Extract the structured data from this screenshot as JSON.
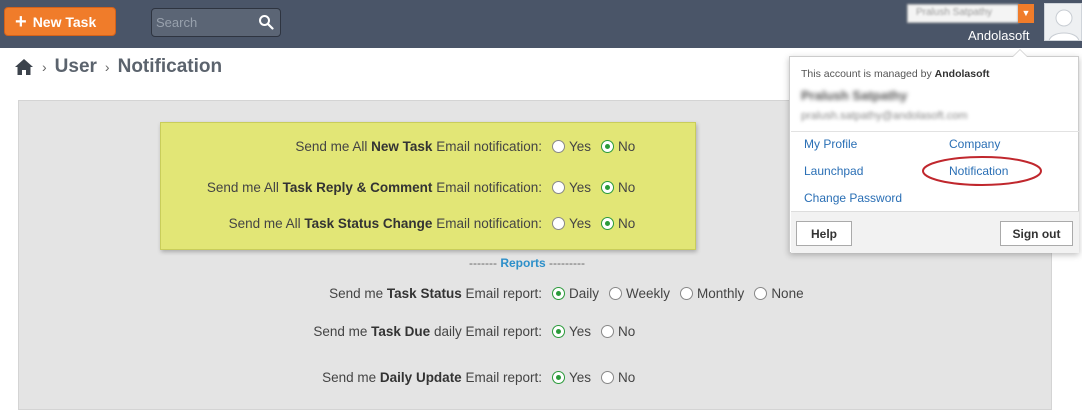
{
  "header": {
    "new_task_label": "New Task",
    "search_placeholder": "Search",
    "user_select_value": "Pralush Satpathy",
    "company": "Andolasoft"
  },
  "breadcrumb": {
    "items": [
      "User",
      "Notification"
    ]
  },
  "email_notifications": [
    {
      "prefix": "Send me All",
      "bold": "New Task",
      "suffix": "Email notification:",
      "options": [
        "Yes",
        "No"
      ],
      "selected": "No"
    },
    {
      "prefix": "Send me All",
      "bold": "Task Reply & Comment",
      "suffix": "Email notification:",
      "options": [
        "Yes",
        "No"
      ],
      "selected": "No"
    },
    {
      "prefix": "Send me All",
      "bold": "Task Status Change",
      "suffix": "Email notification:",
      "options": [
        "Yes",
        "No"
      ],
      "selected": "No"
    }
  ],
  "reports": {
    "divider_left": "-------",
    "title": "Reports",
    "divider_right": "---------",
    "rows": [
      {
        "prefix": "Send me",
        "bold": "Task Status",
        "suffix": "Email report:",
        "options": [
          "Daily",
          "Weekly",
          "Monthly",
          "None"
        ],
        "selected": "Daily"
      },
      {
        "prefix": "Send me",
        "bold": "Task Due",
        "suffix": "daily Email report:",
        "options": [
          "Yes",
          "No"
        ],
        "selected": "Yes"
      },
      {
        "prefix": "Send me",
        "bold": "Daily Update",
        "suffix": "Email report:",
        "options": [
          "Yes",
          "No"
        ],
        "selected": "Yes"
      }
    ]
  },
  "dropdown": {
    "managed_prefix": "This account is managed by",
    "managed_org": "Andolasoft",
    "account_name": "Pralush Satpathy",
    "account_email": "pralush.satpathy@andolasoft.com",
    "links": [
      "My Profile",
      "Company",
      "Launchpad",
      "Notification",
      "Change Password"
    ],
    "help_label": "Help",
    "signout_label": "Sign out"
  },
  "colors": {
    "topbar": "#4a5568",
    "accent_orange": "#f07c2a",
    "yellow_highlight": "#e2e676",
    "link_blue": "#2a6fb5",
    "radio_green": "#2a9a3a",
    "annotation_red": "#c0272d"
  }
}
